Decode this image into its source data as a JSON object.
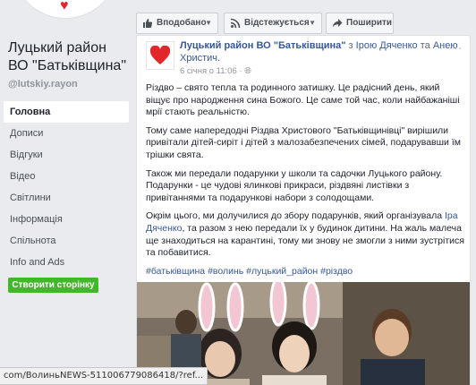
{
  "sidebar": {
    "page_name": "Луцький район ВО \"Батьківщина\"",
    "handle": "@lutskiy.rayon",
    "nav": [
      {
        "label": "Головна",
        "active": true
      },
      {
        "label": "Дописи"
      },
      {
        "label": "Відгуки"
      },
      {
        "label": "Відео"
      },
      {
        "label": "Світлини"
      },
      {
        "label": "Інформація"
      },
      {
        "label": "Спільнота"
      },
      {
        "label": "Info and Ads"
      }
    ],
    "create_button": "Створити сторінку"
  },
  "actionbar": {
    "like": "Вподобано",
    "follow": "Відстежується",
    "share": "Поширити"
  },
  "post": {
    "author": "Луцький район ВО \"Батьківщина\"",
    "with_text": "з",
    "tagged_1": "Ірою Дяченко",
    "and_text": "та",
    "tagged_2": "Анею Христич.",
    "date": "6 січня о 11:06",
    "paragraphs": [
      "Різдво – свято тепла та родинного затишку. Це радісний день, який віщує про народження сина Божого. Це саме той час, коли найбажаніші мрії стають реальністю.",
      "Тому саме напередодні Різдва Христового \"Батьківщинівці\" вирішили привітали дітей-сиріт і дітей з малозабезпечених сімей, подарувавши їм трішки свята.",
      "Також ми передали подарунки у школи та садочки Луцького району. Подарунки - це чудові ялинкові прикраси, різдвяні листівки з привітаннями та подарункові набори з солодощами."
    ],
    "p4_before": "Окрім цього, ми долучилися до збору подарунків, який організувала",
    "p4_link": "Іра Дяченко",
    "p4_after": ", та разом з нею передали їх у будинок дитини. На жаль малеча ще знаходиться на карантині, тому ми знову не змогли з ними зустрітися та побавитися.",
    "hashtags": "#батьківщина #волинь #луцький_район #різдво"
  },
  "status_url": "com/ВолиньNEWS-511006779086418/?ref...",
  "icons": {
    "like": "thumbs-up-icon",
    "follow": "rss-icon",
    "share": "share-arrow-icon"
  },
  "colors": {
    "brand_red": "#e2262a",
    "link_blue": "#365899",
    "create_green": "#42b72a"
  }
}
